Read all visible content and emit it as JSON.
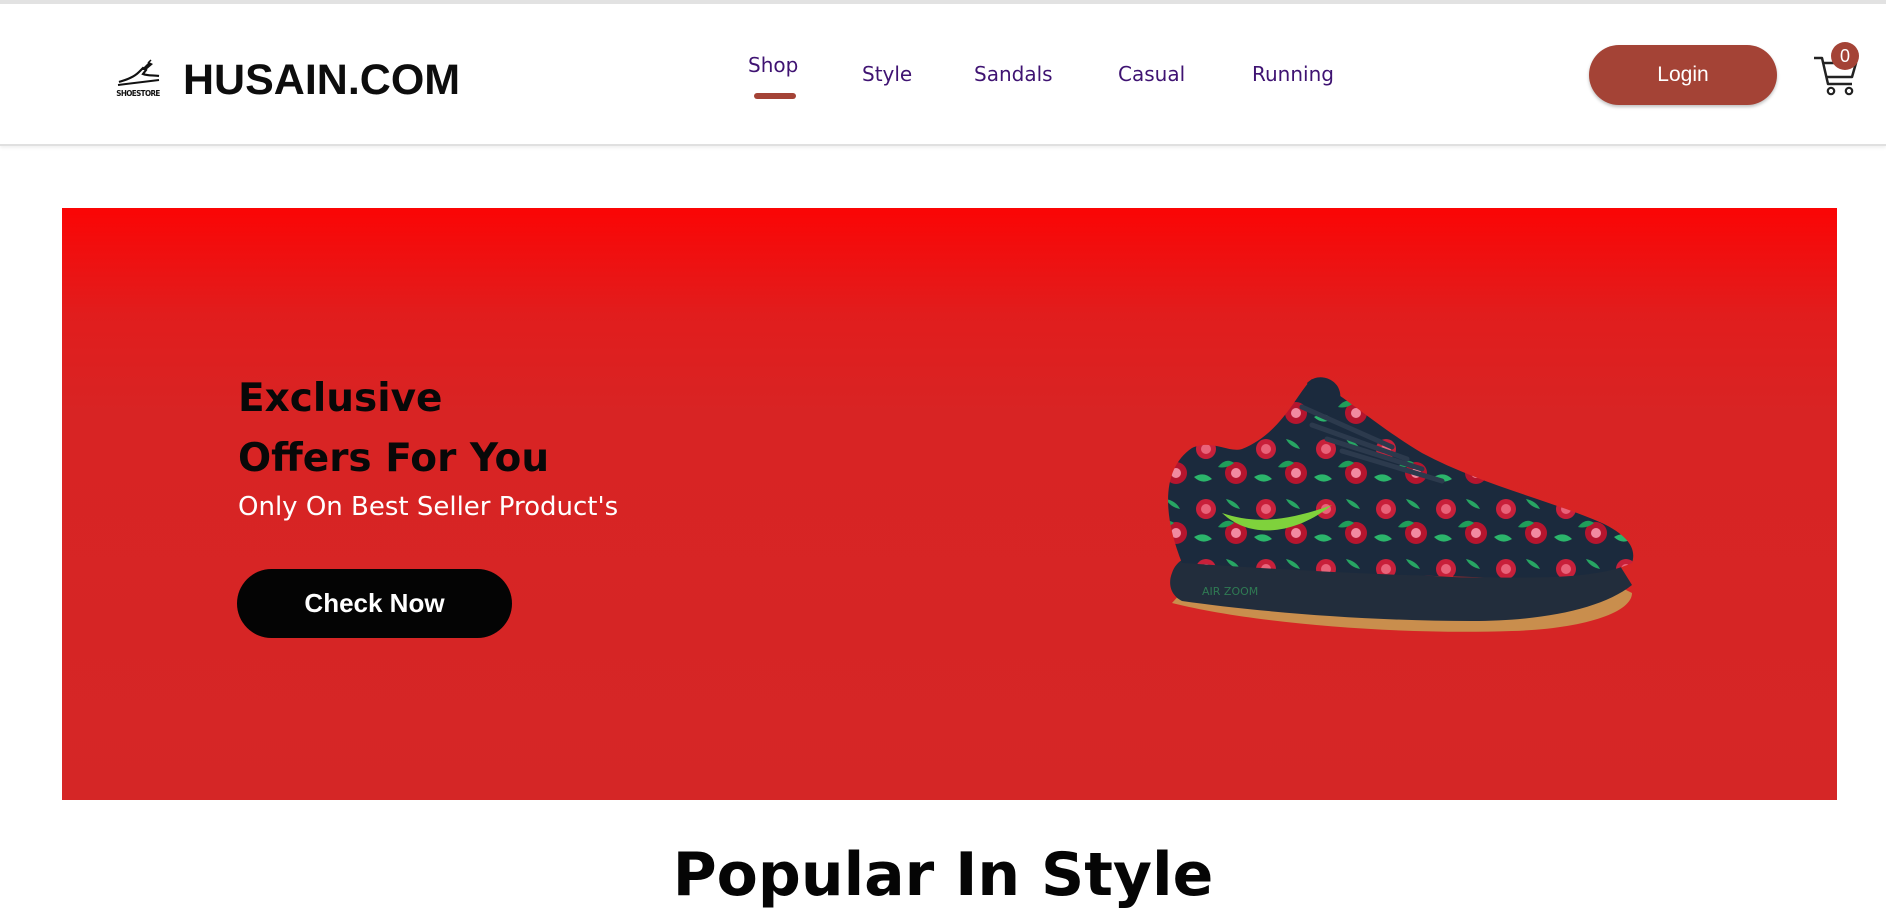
{
  "header": {
    "logo_text": "SHOESTORE",
    "brand_name": "HUSAIN.COM",
    "nav": [
      {
        "label": "Shop",
        "active": true
      },
      {
        "label": "Style",
        "active": false
      },
      {
        "label": "Sandals",
        "active": false
      },
      {
        "label": "Casual",
        "active": false
      },
      {
        "label": "Running",
        "active": false
      }
    ],
    "login_label": "Login",
    "cart_count": "0"
  },
  "hero": {
    "title_line1": "Exclusive",
    "title_line2": "Offers For You",
    "subtitle": "Only On Best Seller Product's",
    "cta_label": "Check Now",
    "image": "sneaker-product-image"
  },
  "section": {
    "title": "Popular In Style"
  },
  "colors": {
    "accent": "#a44336",
    "nav_text": "#3f1372",
    "hero_bg": "#d52626",
    "cta_bg": "#040404"
  }
}
